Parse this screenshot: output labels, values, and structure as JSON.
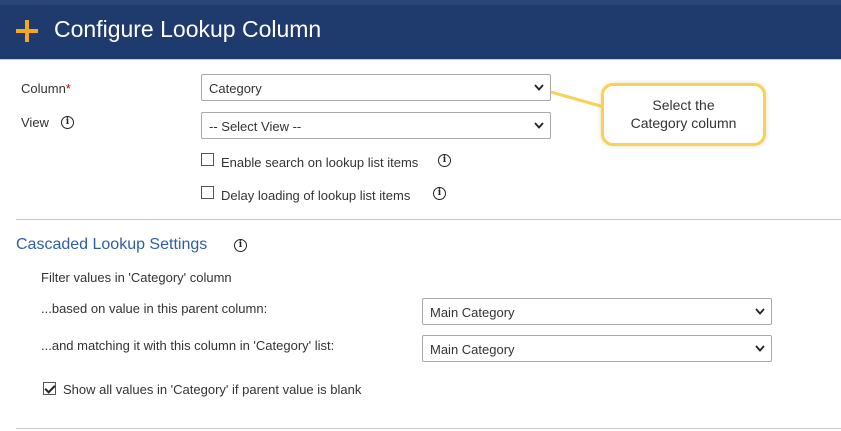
{
  "dialog": {
    "title": "Configure Lookup Column",
    "plus_icon": "plus-icon",
    "accent": "#f5a623",
    "header_bg": "#1f3a6d"
  },
  "form": {
    "column_label": "Column",
    "required_mark": "*",
    "column_value": "Category",
    "view_label": "View",
    "view_value": "-- Select View --",
    "enable_search_label": "Enable search on lookup list items",
    "enable_search_checked": false,
    "delay_loading_label": "Delay loading of lookup list items",
    "delay_loading_checked": false
  },
  "callout": {
    "line1": "Select the",
    "line2": "Category column",
    "border_color": "#f7d25a"
  },
  "cascade": {
    "title": "Cascaded Lookup Settings",
    "title_color": "#2e5fa4",
    "filter_text": "Filter values in 'Category' column",
    "parent_label": "...based on value in this parent column:",
    "parent_value": "Main Category",
    "match_label": "...and matching it with this column in 'Category' list:",
    "match_value": "Main Category",
    "show_all_label": "Show all values in 'Category' if parent value is blank",
    "show_all_checked": true
  }
}
